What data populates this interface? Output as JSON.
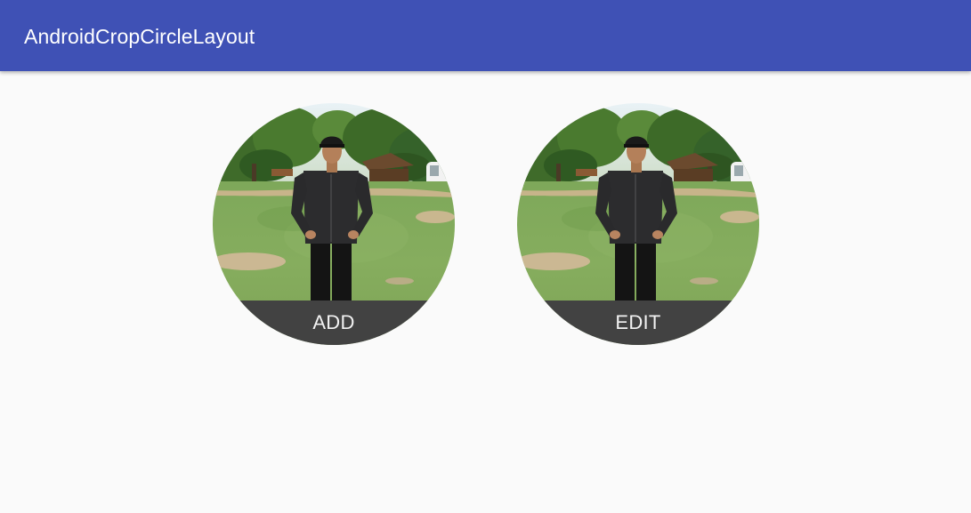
{
  "app_bar": {
    "title": "AndroidCropCircleLayout"
  },
  "crop_circles": [
    {
      "label": "ADD",
      "image": "man-standing-on-grass-photo"
    },
    {
      "label": "EDIT",
      "image": "man-standing-on-grass-photo"
    }
  ],
  "colors": {
    "primary": "#3f51b5",
    "background": "#fafafa",
    "caption_bar": "#424242",
    "title_text": "#ffffff"
  }
}
